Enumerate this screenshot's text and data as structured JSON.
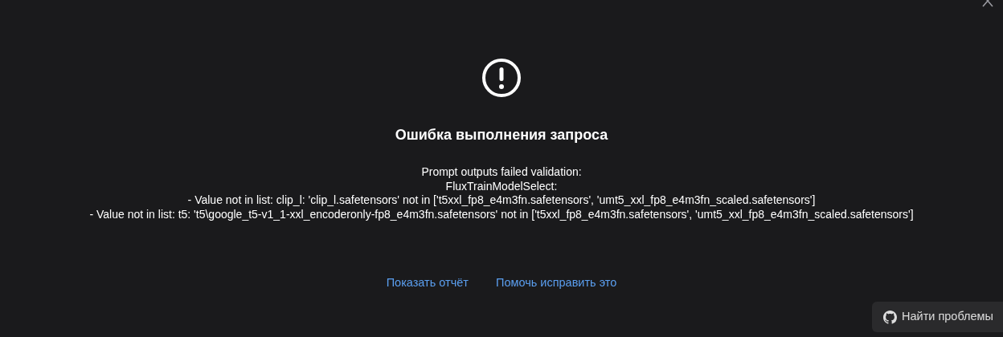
{
  "dialog": {
    "title": "Ошибка выполнения запроса",
    "message_lines": [
      "Prompt outputs failed validation:",
      "FluxTrainModelSelect:",
      "- Value not in list: clip_l: 'clip_l.safetensors' not in ['t5xxl_fp8_e4m3fn.safetensors', 'umt5_xxl_fp8_e4m3fn_scaled.safetensors']",
      "- Value not in list: t5: 't5\\google_t5-v1_1-xxl_encoderonly-fp8_e4m3fn.safetensors' not in ['t5xxl_fp8_e4m3fn.safetensors', 'umt5_xxl_fp8_e4m3fn_scaled.safetensors']"
    ],
    "links": [
      "Показать отчёт",
      "Помочь исправить это"
    ]
  },
  "find_issues_button": {
    "label": "Найти проблемы"
  }
}
